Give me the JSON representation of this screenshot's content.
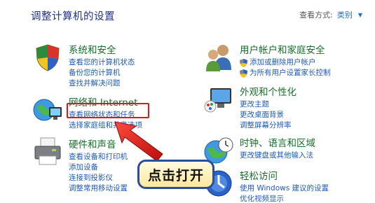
{
  "header": {
    "title": "调整计算机的设置",
    "view_by_label": "查看方式:",
    "view_by_value": "类别"
  },
  "categories": {
    "system": {
      "title": "系统和安全",
      "links": [
        "查看您的计算机状态",
        "备份您的计算机",
        "查找并解决问题"
      ]
    },
    "network": {
      "title": "网络和 Internet",
      "links": [
        "查看网络状态和任务",
        "选择家庭组和共享选项"
      ]
    },
    "hardware": {
      "title": "硬件和声音",
      "links": [
        "查看设备和打印机",
        "添加设备",
        "连接到投影仪",
        "调整常用移动设置"
      ]
    },
    "users": {
      "title": "用户帐户和家庭安全",
      "links": [
        "添加或删除用户帐户",
        "为所有用户设置家长控制"
      ]
    },
    "appearance": {
      "title": "外观和个性化",
      "links": [
        "更改主题",
        "更改桌面背景",
        "调整屏幕分辨率"
      ]
    },
    "clock": {
      "title": "时钟、语言和区域",
      "links": [
        "更改键盘或其他输入法"
      ]
    },
    "ease": {
      "title": "轻松访问",
      "links": [
        "使用 Windows 建议的设置",
        "优化视频显示"
      ]
    }
  },
  "annotation": {
    "callout_text": "点击打开"
  },
  "colors": {
    "link": "#1e5bb5",
    "category_title": "#176e2a",
    "highlight": "#e01818",
    "callout_border": "#2b4e9a"
  },
  "icons": {
    "system": "shield-flag-icon",
    "network": "globe-monitor-icon",
    "hardware": "printer-icon",
    "users": "users-icon",
    "appearance": "monitor-paint-icon",
    "clock": "clock-globe-icon",
    "ease": "ease-of-access-icon"
  }
}
